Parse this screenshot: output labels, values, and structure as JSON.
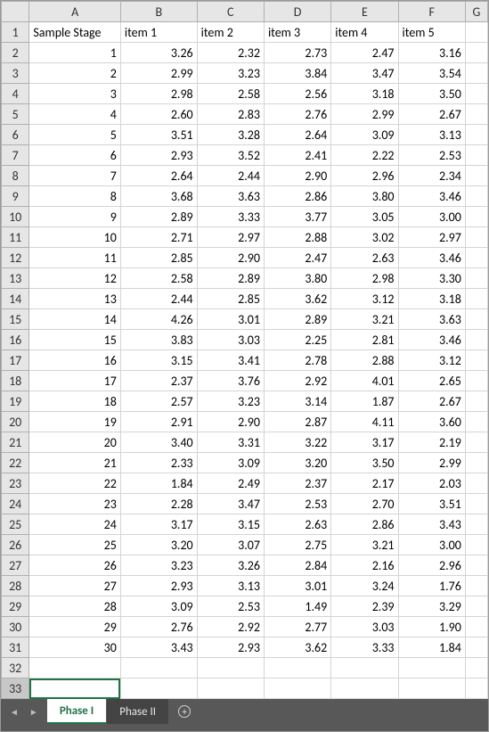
{
  "columns": [
    "A",
    "B",
    "C",
    "D",
    "E",
    "F",
    "G"
  ],
  "header_row": 1,
  "headers": [
    "Sample Stage",
    "item 1",
    "item 2",
    "item 3",
    "item 4",
    "item 5"
  ],
  "rows": [
    {
      "n": 1,
      "v": [
        3.26,
        2.32,
        2.73,
        2.47,
        3.16
      ]
    },
    {
      "n": 2,
      "v": [
        2.99,
        3.23,
        3.84,
        3.47,
        3.54
      ]
    },
    {
      "n": 3,
      "v": [
        2.98,
        2.58,
        2.56,
        3.18,
        3.5
      ]
    },
    {
      "n": 4,
      "v": [
        2.6,
        2.83,
        2.76,
        2.99,
        2.67
      ]
    },
    {
      "n": 5,
      "v": [
        3.51,
        3.28,
        2.64,
        3.09,
        3.13
      ]
    },
    {
      "n": 6,
      "v": [
        2.93,
        3.52,
        2.41,
        2.22,
        2.53
      ]
    },
    {
      "n": 7,
      "v": [
        2.64,
        2.44,
        2.9,
        2.96,
        2.34
      ]
    },
    {
      "n": 8,
      "v": [
        3.68,
        3.63,
        2.86,
        3.8,
        3.46
      ]
    },
    {
      "n": 9,
      "v": [
        2.89,
        3.33,
        3.77,
        3.05,
        3.0
      ]
    },
    {
      "n": 10,
      "v": [
        2.71,
        2.97,
        2.88,
        3.02,
        2.97
      ]
    },
    {
      "n": 11,
      "v": [
        2.85,
        2.9,
        2.47,
        2.63,
        3.46
      ]
    },
    {
      "n": 12,
      "v": [
        2.58,
        2.89,
        3.8,
        2.98,
        3.3
      ]
    },
    {
      "n": 13,
      "v": [
        2.44,
        2.85,
        3.62,
        3.12,
        3.18
      ]
    },
    {
      "n": 14,
      "v": [
        4.26,
        3.01,
        2.89,
        3.21,
        3.63
      ]
    },
    {
      "n": 15,
      "v": [
        3.83,
        3.03,
        2.25,
        2.81,
        3.46
      ]
    },
    {
      "n": 16,
      "v": [
        3.15,
        3.41,
        2.78,
        2.88,
        3.12
      ]
    },
    {
      "n": 17,
      "v": [
        2.37,
        3.76,
        2.92,
        4.01,
        2.65
      ]
    },
    {
      "n": 18,
      "v": [
        2.57,
        3.23,
        3.14,
        1.87,
        2.67
      ]
    },
    {
      "n": 19,
      "v": [
        2.91,
        2.9,
        2.87,
        4.11,
        3.6
      ]
    },
    {
      "n": 20,
      "v": [
        3.4,
        3.31,
        3.22,
        3.17,
        2.19
      ]
    },
    {
      "n": 21,
      "v": [
        2.33,
        3.09,
        3.2,
        3.5,
        2.99
      ]
    },
    {
      "n": 22,
      "v": [
        1.84,
        2.49,
        2.37,
        2.17,
        2.03
      ]
    },
    {
      "n": 23,
      "v": [
        2.28,
        3.47,
        2.53,
        2.7,
        3.51
      ]
    },
    {
      "n": 24,
      "v": [
        3.17,
        3.15,
        2.63,
        2.86,
        3.43
      ]
    },
    {
      "n": 25,
      "v": [
        3.2,
        3.07,
        2.75,
        3.21,
        3.0
      ]
    },
    {
      "n": 26,
      "v": [
        3.23,
        3.26,
        2.84,
        2.16,
        2.96
      ]
    },
    {
      "n": 27,
      "v": [
        2.93,
        3.13,
        3.01,
        3.24,
        1.76
      ]
    },
    {
      "n": 28,
      "v": [
        3.09,
        2.53,
        1.49,
        2.39,
        3.29
      ]
    },
    {
      "n": 29,
      "v": [
        2.76,
        2.92,
        2.77,
        3.03,
        1.9
      ]
    },
    {
      "n": 30,
      "v": [
        3.43,
        2.93,
        3.62,
        3.33,
        1.84
      ]
    }
  ],
  "empty_rows": [
    32,
    33
  ],
  "selected_row_header": 33,
  "selected_cell": "A33",
  "tabs": [
    {
      "label": "Phase I",
      "active": true
    },
    {
      "label": "Phase II",
      "active": false
    }
  ],
  "nav": {
    "prev": "◄",
    "next": "►"
  },
  "add_tab_glyph": "+"
}
